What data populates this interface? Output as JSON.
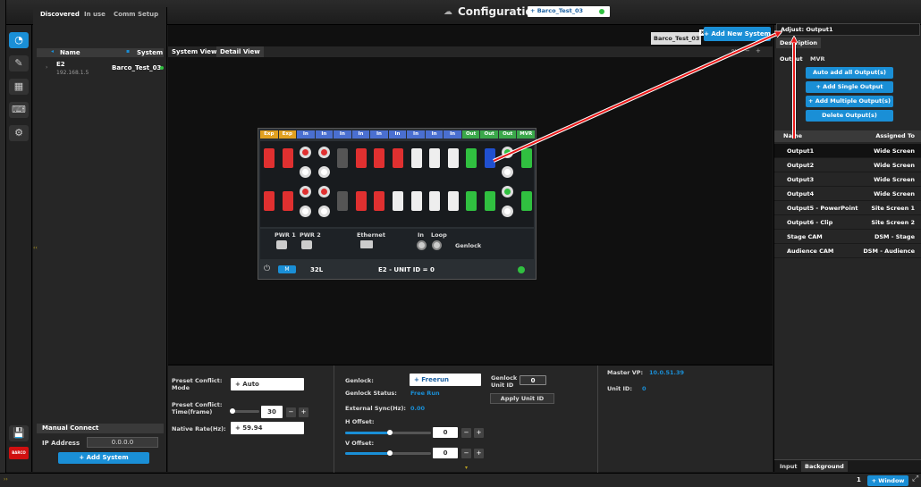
{
  "title": {
    "text": "Configuration",
    "preset": "+ Barco_Test_03"
  },
  "left_tabs": [
    "Discovered",
    "In use",
    "Comm Setup"
  ],
  "device_table": {
    "col_name": "Name",
    "col_system": "System",
    "rows": [
      {
        "name": "E2",
        "ip": "192.168.1.5",
        "system": "Barco_Test_03"
      }
    ]
  },
  "manual_connect": {
    "title": "Manual Connect",
    "ip_label": "IP Address",
    "ip_value": "0.0.0.0",
    "add_button": "+ Add System"
  },
  "center": {
    "views": [
      "System View",
      "Detail View"
    ],
    "system_tab": "Barco_Test_03",
    "add_new_system": "+ Add New System",
    "zoom": "%",
    "zoom_minus": "−",
    "zoom_plus": "+",
    "channels": [
      "Exp",
      "Exp",
      "In",
      "In",
      "In",
      "In",
      "In",
      "In",
      "In",
      "In",
      "In",
      "Out",
      "Out",
      "Out",
      "MVR"
    ],
    "ports": [
      {
        "label": "PWR 1"
      },
      {
        "label": "PWR 2"
      },
      {
        "label": "Ethernet"
      },
      {
        "label": "In"
      },
      {
        "label": "Loop"
      },
      {
        "label": "Genlock"
      }
    ],
    "device_footer": {
      "model": "32L",
      "mode": "M",
      "unit": "E2 - UNIT ID = 0"
    }
  },
  "settings": {
    "preset_conflict_mode_label": "Preset Conflict: Mode",
    "preset_conflict_mode_value": "+ Auto",
    "preset_conflict_time_label": "Preset Conflict: Time(frame)",
    "preset_conflict_time_value": "30",
    "preset_conflict_time_level": 0.05,
    "native_rate_label": "Native Rate(Hz):",
    "native_rate_value": "+ 59.94",
    "genlock_label": "Genlock:",
    "genlock_value": "+ Freerun",
    "genlock_unit_id_label": "Genlock Unit ID",
    "genlock_unit_id_value": "0",
    "genlock_status_label": "Genlock Status:",
    "genlock_status_value": "Free Run",
    "apply_unit_id": "Apply Unit ID",
    "external_sync_label": "External Sync(Hz):",
    "external_sync_value": "0.00",
    "h_offset_label": "H Offset:",
    "h_offset_value": "0",
    "h_offset_level": 0.52,
    "v_offset_label": "V Offset:",
    "v_offset_value": "0",
    "v_offset_level": 0.52,
    "master_vp_label": "Master VP:",
    "master_vp_value": "10.0.51.39",
    "unit_id_label": "Unit ID:",
    "unit_id_value": "0",
    "stepper_minus": "−",
    "stepper_plus": "+"
  },
  "right": {
    "adjust_tab": "Adjust: Output1",
    "description_tab": "Description",
    "sub_tabs": [
      "Output",
      "MVR"
    ],
    "buttons": [
      "Auto add all Output(s)",
      "+ Add Single Output",
      "+ Add Multiple Output(s)",
      "Delete Output(s)"
    ],
    "col_name": "Name",
    "col_assigned": "Assigned To",
    "outputs": [
      {
        "name": "Output1",
        "assigned": "Wide Screen"
      },
      {
        "name": "Output2",
        "assigned": "Wide Screen"
      },
      {
        "name": "Output3",
        "assigned": "Wide Screen"
      },
      {
        "name": "Output4",
        "assigned": "Wide Screen"
      },
      {
        "name": "Output5 - PowerPoint",
        "assigned": "Site Screen 1"
      },
      {
        "name": "Output6 - Clip",
        "assigned": "Site Screen 2"
      },
      {
        "name": "Stage CAM",
        "assigned": "DSM - Stage"
      },
      {
        "name": "Audience CAM",
        "assigned": "DSM - Audience"
      }
    ],
    "bottom_tabs": [
      "Input",
      "Background"
    ]
  },
  "bottom_bar": {
    "page": "1",
    "window_button": "+ Window"
  },
  "colors": {
    "accent": "#1a8fd6",
    "exp": "#e0a020",
    "in": "#4a6fd0",
    "out": "#3aa84a",
    "port_red": "#e03030",
    "port_green": "#30c040",
    "port_blue": "#2050d0"
  }
}
